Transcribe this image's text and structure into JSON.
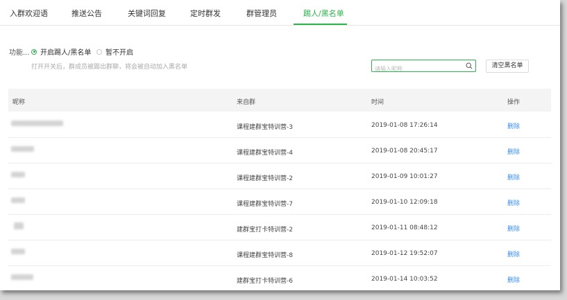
{
  "tabs": [
    {
      "label": "入群欢迎语"
    },
    {
      "label": "推送公告"
    },
    {
      "label": "关键词回复"
    },
    {
      "label": "定时群发"
    },
    {
      "label": "群管理员"
    },
    {
      "label": "踢人/黑名单"
    }
  ],
  "active_tab": "踢人/黑名单",
  "function": {
    "label": "功能...",
    "option_on": "开启踢人/黑名单",
    "option_off": "暂不开启",
    "selected": "开启踢人/黑名单",
    "hint": "打开开关后，群成员被踢出群聊，将会被自动加入黑名单"
  },
  "search": {
    "placeholder": "请输入昵称",
    "value": ""
  },
  "clear_button": "清空黑名单",
  "table": {
    "headers": [
      "昵称",
      "来自群",
      "时间",
      "操作"
    ],
    "rows": [
      {
        "group": "课程建群宝特训营-3",
        "time": "2019-01-08 17:26:14",
        "action": "删除"
      },
      {
        "group": "课程建群宝特训营-4",
        "time": "2019-01-08 20:45:17",
        "action": "删除"
      },
      {
        "group": "课程建群宝特训营-2",
        "time": "2019-01-09 10:01:27",
        "action": "删除"
      },
      {
        "group": "课程建群宝特训营-7",
        "time": "2019-01-10 12:09:18",
        "action": "删除"
      },
      {
        "group": "建群宝打卡特训营-2",
        "time": "2019-01-11 08:48:12",
        "action": "删除"
      },
      {
        "group": "课程建群宝特训营-8",
        "time": "2019-01-12 19:52:07",
        "action": "删除"
      },
      {
        "group": "建群宝打卡特训营-6",
        "time": "2019-01-14 10:03:52",
        "action": "删除"
      }
    ]
  },
  "colors": {
    "accent": "#2bb34a",
    "link": "#3a8ee6"
  }
}
